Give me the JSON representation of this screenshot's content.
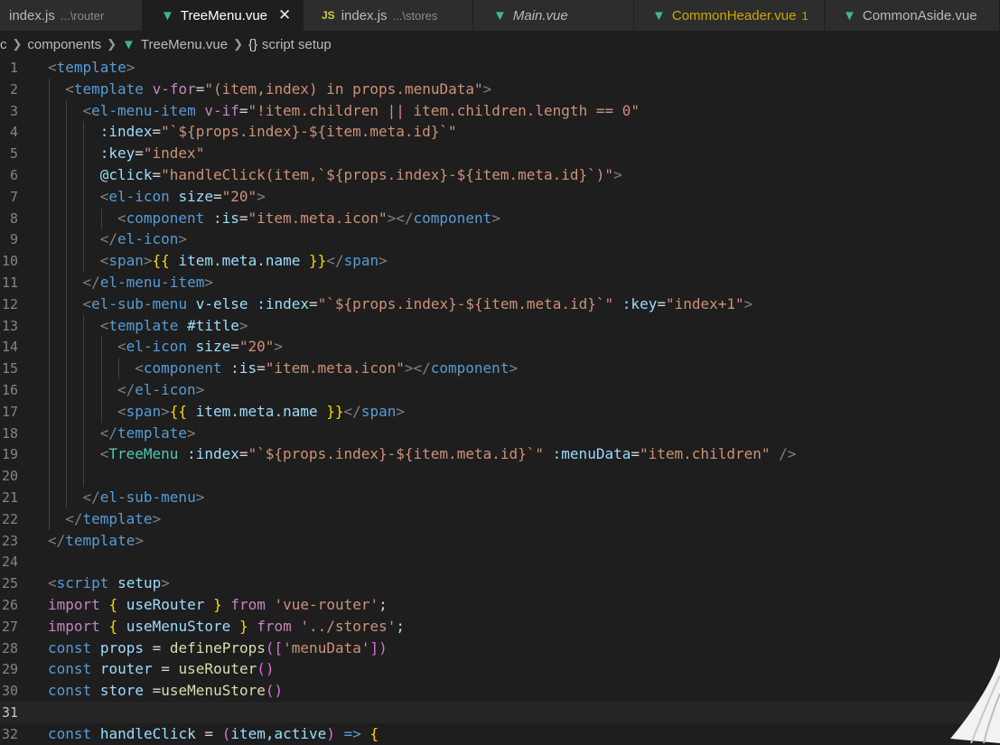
{
  "tabs": [
    {
      "name": "index.js",
      "desc": "...\\router",
      "icon": "js-icon",
      "active": false
    },
    {
      "name": "TreeMenu.vue",
      "icon": "vue-icon",
      "active": true
    },
    {
      "name": "index.js",
      "desc": "...\\stores",
      "icon": "JS",
      "active": false
    },
    {
      "name": "Main.vue",
      "icon": "vue-icon",
      "active": false
    },
    {
      "name": "CommonHeader.vue",
      "count": "1",
      "icon": "vue-icon",
      "active": false
    },
    {
      "name": "CommonAside.vue",
      "icon": "vue-icon",
      "active": false
    }
  ],
  "breadcrumb": {
    "part1": "c",
    "part2": "components",
    "file": "TreeMenu.vue",
    "symbol_icon": "{}",
    "symbol": "script setup"
  },
  "editor": {
    "current_line": 31,
    "lines": [
      {
        "n": "1",
        "text": "<template>"
      },
      {
        "n": "2",
        "text": "<template v-for=\"(item,index) in props.menuData\">"
      },
      {
        "n": "3",
        "text": "<el-menu-item v-if=\"!item.children || item.children.length == 0\""
      },
      {
        "n": "4",
        "text": ":index=\"`${props.index}-${item.meta.id}`\""
      },
      {
        "n": "5",
        "text": ":key=\"index\""
      },
      {
        "n": "6",
        "text": "@click=\"handleClick(item,`${props.index}-${item.meta.id}`)\">"
      },
      {
        "n": "7",
        "text": "<el-icon size=\"20\">"
      },
      {
        "n": "8",
        "text": "<component :is=\"item.meta.icon\"></component>"
      },
      {
        "n": "9",
        "text": "</el-icon>"
      },
      {
        "n": "10",
        "text": "<span>{{ item.meta.name }}</span>"
      },
      {
        "n": "11",
        "text": "</el-menu-item>"
      },
      {
        "n": "12",
        "text": "<el-sub-menu v-else :index=\"`${props.index}-${item.meta.id}`\" :key=\"index+1\">"
      },
      {
        "n": "13",
        "text": "<template #title>"
      },
      {
        "n": "14",
        "text": "<el-icon size=\"20\">"
      },
      {
        "n": "15",
        "text": "<component :is=\"item.meta.icon\"></component>"
      },
      {
        "n": "16",
        "text": "</el-icon>"
      },
      {
        "n": "17",
        "text": "<span>{{ item.meta.name }}</span>"
      },
      {
        "n": "18",
        "text": "</template>"
      },
      {
        "n": "19",
        "text": "<TreeMenu :index=\"`${props.index}-${item.meta.id}`\" :menuData=\"item.children\" />"
      },
      {
        "n": "20",
        "text": ""
      },
      {
        "n": "21",
        "text": "</el-sub-menu>"
      },
      {
        "n": "22",
        "text": "</template>"
      },
      {
        "n": "23",
        "text": "</template>"
      },
      {
        "n": "24",
        "text": ""
      },
      {
        "n": "25",
        "text": "<script setup>"
      },
      {
        "n": "26",
        "text": "import { useRouter } from 'vue-router';"
      },
      {
        "n": "27",
        "text": "import { useMenuStore } from '../stores';"
      },
      {
        "n": "28",
        "text": "const props = defineProps(['menuData'])"
      },
      {
        "n": "29",
        "text": "const router = useRouter()"
      },
      {
        "n": "30",
        "text": "const store =useMenuStore()"
      },
      {
        "n": "31",
        "text": ""
      },
      {
        "n": "32",
        "text": "const handleClick = (item,active) => {"
      }
    ]
  }
}
